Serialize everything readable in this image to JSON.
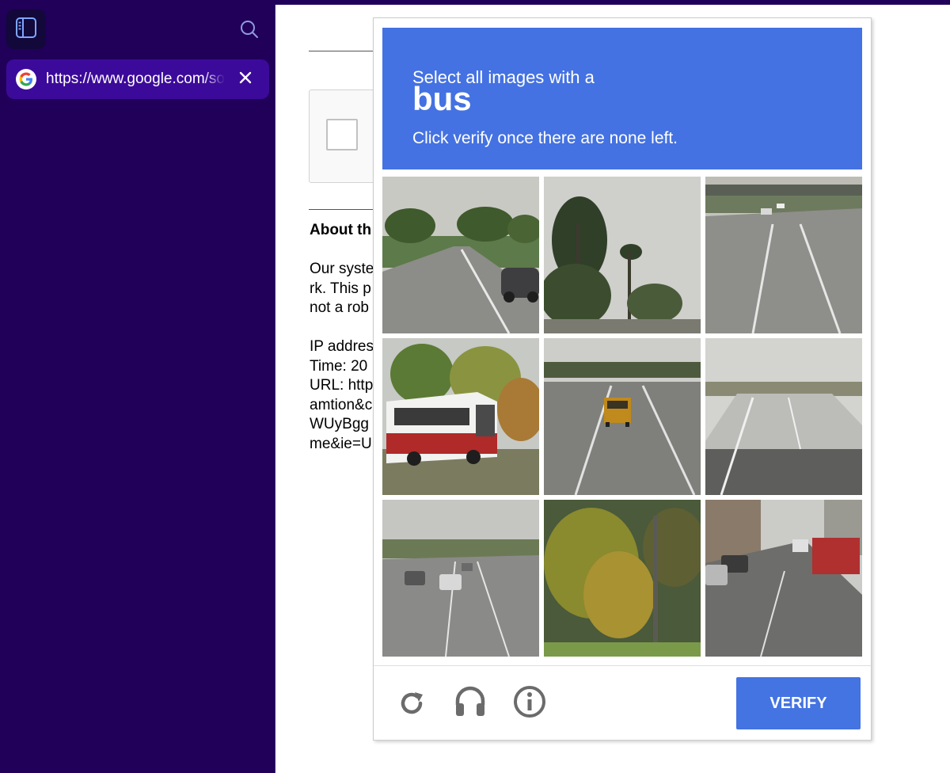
{
  "sidebar": {
    "tab": {
      "url": "https://www.google.com/sorry/index",
      "favicon": "google-g-icon"
    }
  },
  "page": {
    "about_title": "About th",
    "body_lines": [
      "Our syste",
      "rk. This p",
      "not a rob"
    ],
    "info_lines": [
      "IP addres",
      "Time: 20",
      "URL: http",
      "amtion&c",
      "WUyBgg",
      "me&ie=U"
    ]
  },
  "challenge": {
    "line1": "Select all images with a",
    "target": "bus",
    "line3": "Click verify once there are none left.",
    "verify_label": "VERIFY",
    "header_color": "#4472e2",
    "tiles": [
      "road-with-trees-and-car",
      "palm-trees",
      "highway-overpass",
      "white-red-bus",
      "highway-yellow-bus",
      "empty-wide-road",
      "highway-traffic",
      "autumn-trees-and-pole",
      "street-red-truck"
    ]
  }
}
